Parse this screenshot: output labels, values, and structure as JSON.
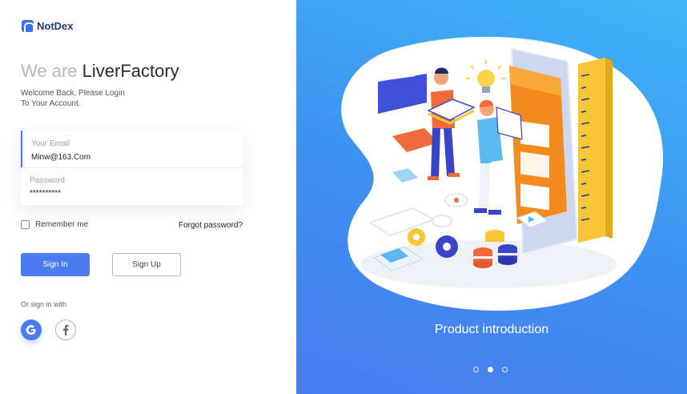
{
  "brand": {
    "name": "NotDex"
  },
  "login": {
    "headline_prefix": "We are",
    "headline_brand": "LiverFactory",
    "welcome_line1": "Welcome Back, Please Login",
    "welcome_line2": "To Your Account.",
    "email": {
      "label": "Your Email",
      "value": "Minw@163.Com"
    },
    "password": {
      "label": "Password",
      "value": "**********"
    },
    "remember_label": "Remember me",
    "remember_checked": false,
    "forgot_label": "Forgot password?",
    "signin_label": "Sign In",
    "signup_label": "Sign Up",
    "or_sign_in": "Or sign in with",
    "social": [
      {
        "icon": "google-icon"
      },
      {
        "icon": "facebook-icon"
      }
    ]
  },
  "promo": {
    "title": "Product introduction",
    "carousel_count": 3,
    "carousel_active": 2
  },
  "colors": {
    "accent": "#4a7cf0",
    "panel_top": "#3fb6f7",
    "panel_bottom": "#3d8ff1"
  }
}
